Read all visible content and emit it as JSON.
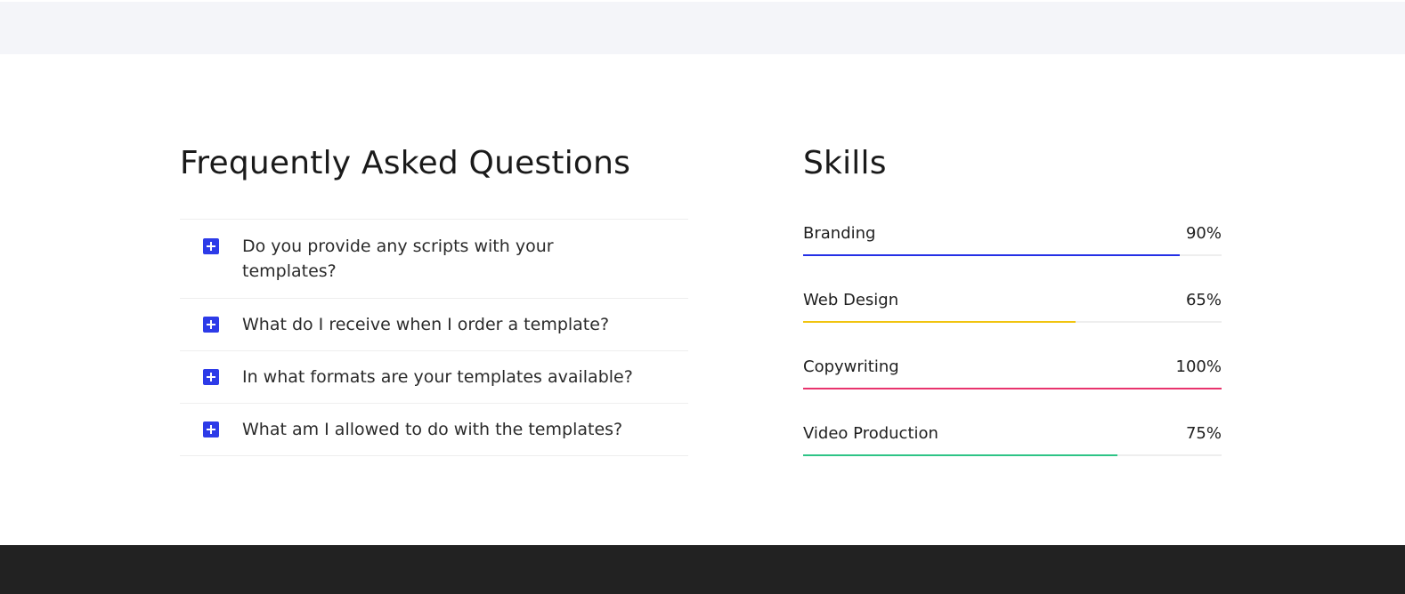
{
  "faq": {
    "title": "Frequently Asked Questions",
    "items": [
      {
        "question": "Do you provide any scripts with your templates?"
      },
      {
        "question": "What do I receive when I order a template?"
      },
      {
        "question": "In what formats are your templates available?"
      },
      {
        "question": "What am I allowed to do with the templates?"
      }
    ],
    "icon": "plus-icon",
    "icon_color": "#2d3be8"
  },
  "skills": {
    "title": "Skills",
    "items": [
      {
        "label": "Branding",
        "percent_text": "90%",
        "value": 90,
        "color": "#2430e6"
      },
      {
        "label": "Web Design",
        "percent_text": "65%",
        "value": 65,
        "color": "#f1c40f"
      },
      {
        "label": "Copywriting",
        "percent_text": "100%",
        "value": 100,
        "color": "#e8336d"
      },
      {
        "label": "Video Production",
        "percent_text": "75%",
        "value": 75,
        "color": "#2ec486"
      }
    ]
  },
  "colors": {
    "top_band": "#f4f5f9",
    "footer_band": "#222222"
  }
}
